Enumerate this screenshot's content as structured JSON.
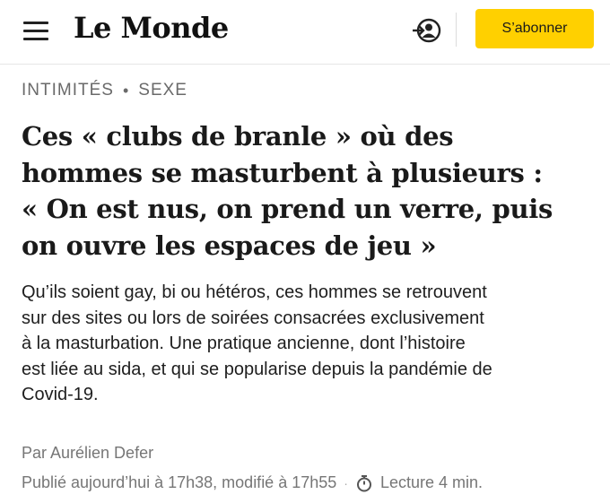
{
  "header": {
    "logo": "Le Monde",
    "subscribe_label": "S’abonner",
    "icons": [
      "menu-icon",
      "account-icon"
    ],
    "accent_color": "#ffd000"
  },
  "breadcrumb": {
    "section": "INTIMITÉS",
    "separator": "•",
    "subsection": "SEXE"
  },
  "article": {
    "title_lines": [
      "Ces « clubs de branle » où des",
      "hommes se masturbent à plusieurs :",
      "« On est nus, on prend un verre, puis",
      "on ouvre les espaces de jeu »"
    ],
    "lead_lines": [
      "Qu’ils soient gay, bi ou hétéros, ces hommes se retrouvent",
      "sur des sites ou lors de soirées consacrées exclusivement",
      "à la masturbation. Une pratique ancienne, dont l’histoire",
      "est liée au sida, et qui se popularise depuis la pandémie de",
      "Covid-19."
    ],
    "byline": "Par Aurélien Defer",
    "published": "Publié aujourd’hui à 17h38, modifié à 17h55",
    "meta_separator": "·",
    "reading_time": "Lecture 4 min."
  }
}
